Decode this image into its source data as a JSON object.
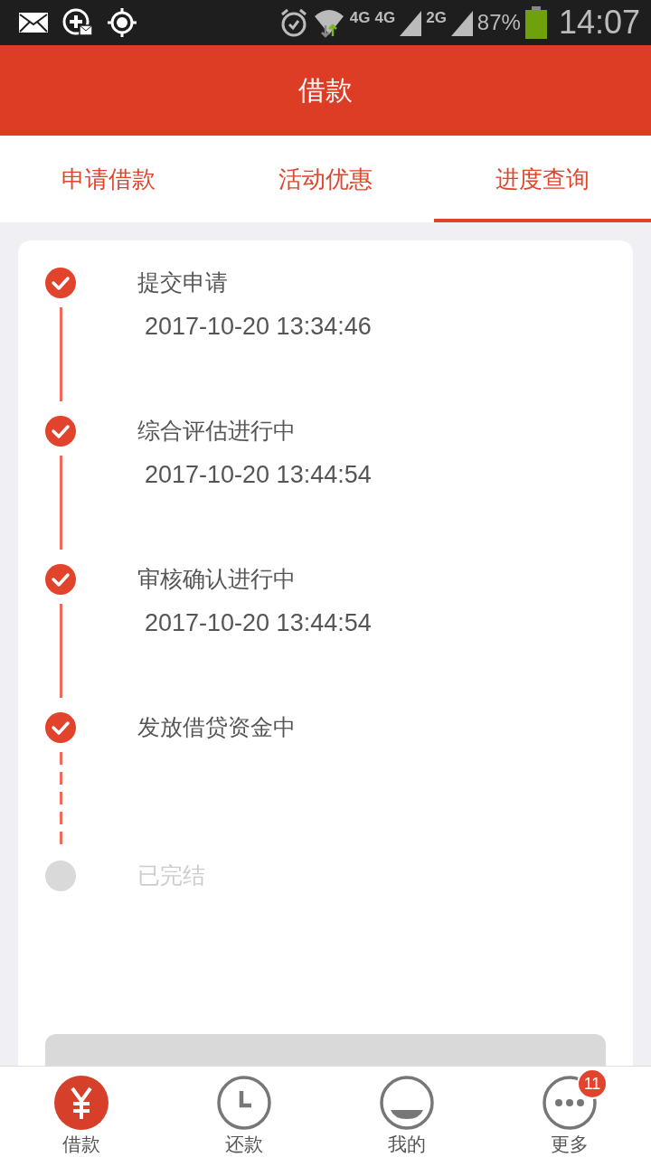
{
  "status_bar": {
    "network_1": "4G",
    "network_2": "4G",
    "network_3": "2G",
    "battery": "87%",
    "time": "14:07"
  },
  "header": {
    "title": "借款"
  },
  "tabs": [
    {
      "label": "申请借款",
      "selected": false
    },
    {
      "label": "活动优惠",
      "selected": false
    },
    {
      "label": "进度查询",
      "selected": true
    }
  ],
  "progress": [
    {
      "title": "提交申请",
      "time": "2017-10-20 13:34:46",
      "done": true
    },
    {
      "title": "综合评估进行中",
      "time": "2017-10-20 13:44:54",
      "done": true
    },
    {
      "title": "审核确认进行中",
      "time": "2017-10-20 13:44:54",
      "done": true
    },
    {
      "title": "发放借贷资金中",
      "done": true
    },
    {
      "title": "已完结",
      "done": false
    }
  ],
  "bottom_nav": [
    {
      "label": "借款",
      "selected": true
    },
    {
      "label": "还款",
      "selected": false
    },
    {
      "label": "我的",
      "selected": false
    },
    {
      "label": "更多",
      "selected": false,
      "badge": "11"
    }
  ]
}
